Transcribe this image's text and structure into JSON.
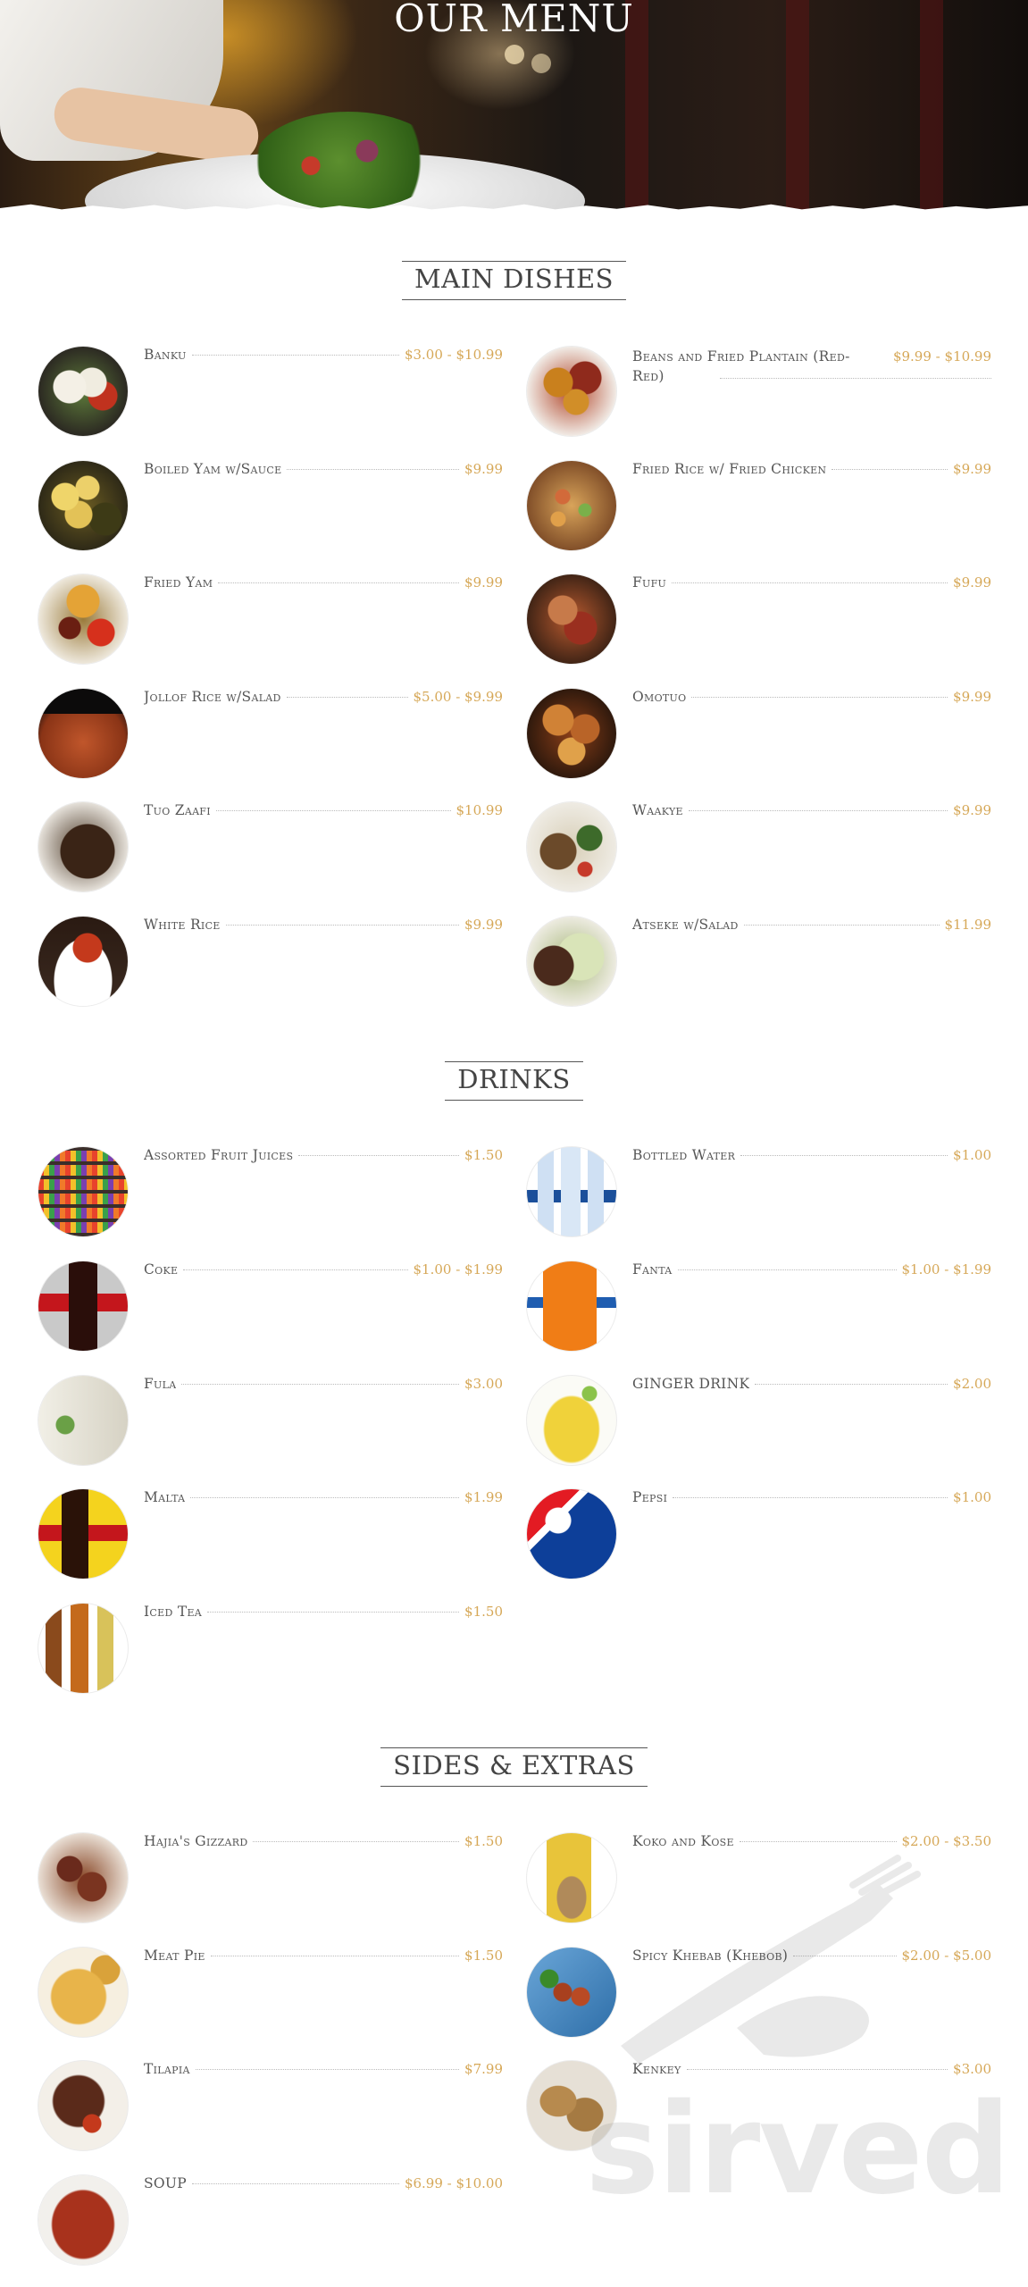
{
  "header": {
    "title": "OUR MENU"
  },
  "colors": {
    "price": "#d6a858",
    "text": "#555555",
    "heading": "#444444"
  },
  "sections": {
    "main": {
      "title": "MAIN DISHES",
      "items": [
        {
          "name": "Banku",
          "price": "$3.00 - $10.99",
          "icon": "banku-photo"
        },
        {
          "name": "Beans and Fried Plantain (Red-Red)",
          "price": "$9.99 - $10.99",
          "icon": "red-red-photo"
        },
        {
          "name": "Boiled Yam w/Sauce",
          "price": "$9.99",
          "icon": "boiled-yam-photo"
        },
        {
          "name": "Fried Rice w/ Fried Chicken",
          "price": "$9.99",
          "icon": "fried-rice-photo"
        },
        {
          "name": "Fried Yam",
          "price": "$9.99",
          "icon": "fried-yam-photo"
        },
        {
          "name": "Fufu",
          "price": "$9.99",
          "icon": "fufu-photo"
        },
        {
          "name": "Jollof Rice w/Salad",
          "price": "$5.00 - $9.99",
          "icon": "jollof-photo"
        },
        {
          "name": "Omotuo",
          "price": "$9.99",
          "icon": "omotuo-photo"
        },
        {
          "name": "Tuo Zaafi",
          "price": "$10.99",
          "icon": "tuo-zaafi-photo"
        },
        {
          "name": "Waakye",
          "price": "$9.99",
          "icon": "waakye-photo"
        },
        {
          "name": "White Rice",
          "price": "$9.99",
          "icon": "white-rice-photo"
        },
        {
          "name": "Atseke w/Salad",
          "price": "$11.99",
          "icon": "atseke-photo"
        }
      ]
    },
    "drinks": {
      "title": "DRINKS",
      "items": [
        {
          "name": "Assorted Fruit Juices",
          "price": "$1.50",
          "icon": "juices-photo"
        },
        {
          "name": "Bottled Water",
          "price": "$1.00",
          "icon": "water-photo"
        },
        {
          "name": "Coke",
          "price": "$1.00 - $1.99",
          "icon": "coke-photo"
        },
        {
          "name": "Fanta",
          "price": "$1.00 - $1.99",
          "icon": "fanta-photo"
        },
        {
          "name": "Fula",
          "price": "$3.00",
          "icon": "fula-photo"
        },
        {
          "name": "GINGER DRINK",
          "price": "$2.00",
          "icon": "ginger-photo"
        },
        {
          "name": "Malta",
          "price": "$1.99",
          "icon": "malta-photo"
        },
        {
          "name": "Pepsi",
          "price": "$1.00",
          "icon": "pepsi-photo"
        },
        {
          "name": "Iced Tea",
          "price": "$1.50",
          "icon": "iced-tea-photo"
        }
      ]
    },
    "sides": {
      "title": "SIDES & EXTRAS",
      "items": [
        {
          "name": "Hajia's Gizzard",
          "price": "$1.50",
          "icon": "gizzard-photo"
        },
        {
          "name": "Koko and Kose",
          "price": "$2.00 - $3.50",
          "icon": "koko-photo"
        },
        {
          "name": "Meat Pie",
          "price": "$1.50",
          "icon": "meat-pie-photo"
        },
        {
          "name": "Spicy Khebab (Khebob)",
          "price": "$2.00 - $5.00",
          "icon": "khebab-photo"
        },
        {
          "name": "Tilapia",
          "price": "$7.99",
          "icon": "tilapia-photo"
        },
        {
          "name": "Kenkey",
          "price": "$3.00",
          "icon": "kenkey-photo"
        },
        {
          "name": "SOUP",
          "price": "$6.99 - $10.00",
          "icon": "soup-photo"
        }
      ]
    }
  },
  "watermark": {
    "text": "sirved",
    "icon": "fork-knife-icon"
  }
}
